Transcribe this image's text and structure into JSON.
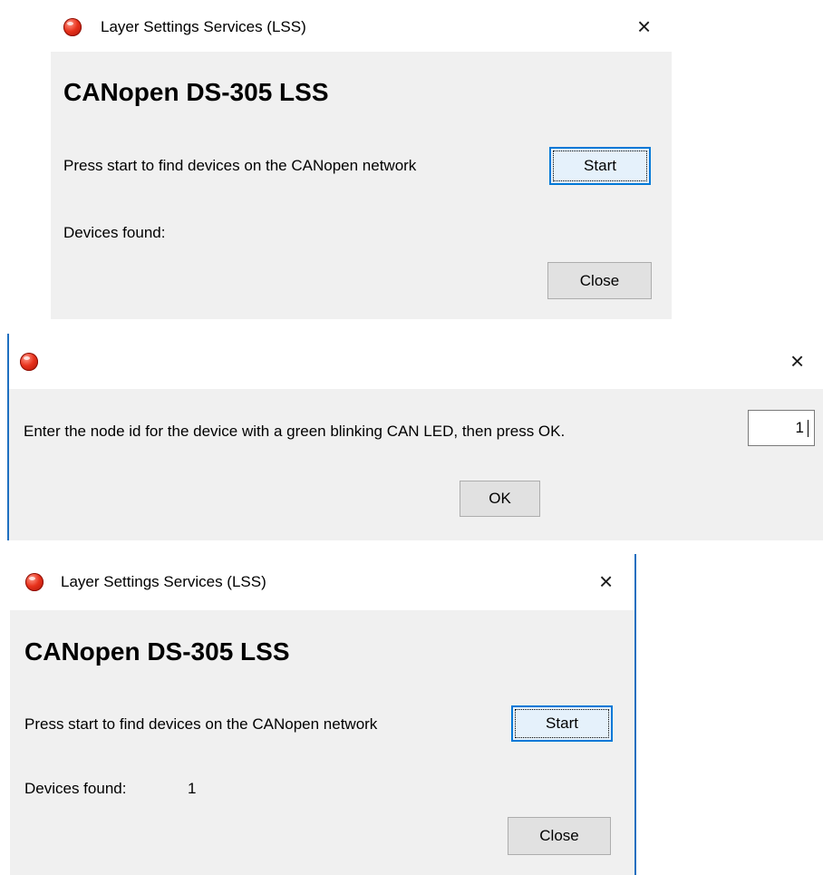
{
  "dialog1": {
    "title": "Layer Settings Services (LSS)",
    "heading": "CANopen DS-305 LSS",
    "instruction": "Press start to find devices on the CANopen network",
    "start_label": "Start",
    "devices_label": "Devices found:",
    "devices_value": "",
    "close_label": "Close",
    "close_icon": "×"
  },
  "dialog2": {
    "prompt": "Enter the node id for the device with a green blinking CAN LED, then press OK.",
    "node_id_value": "1",
    "ok_label": "OK",
    "close_icon": "×"
  },
  "dialog3": {
    "title": "Layer Settings Services (LSS)",
    "heading": "CANopen DS-305 LSS",
    "instruction": "Press start to find devices on the CANopen network",
    "start_label": "Start",
    "devices_label": "Devices found:",
    "devices_value": "1",
    "close_label": "Close",
    "close_icon": "×"
  },
  "colors": {
    "dialog_bg": "#f0f0f0",
    "title_bg": "#ffffff",
    "accent": "#0078d7",
    "button_bg": "#e1e1e1"
  }
}
